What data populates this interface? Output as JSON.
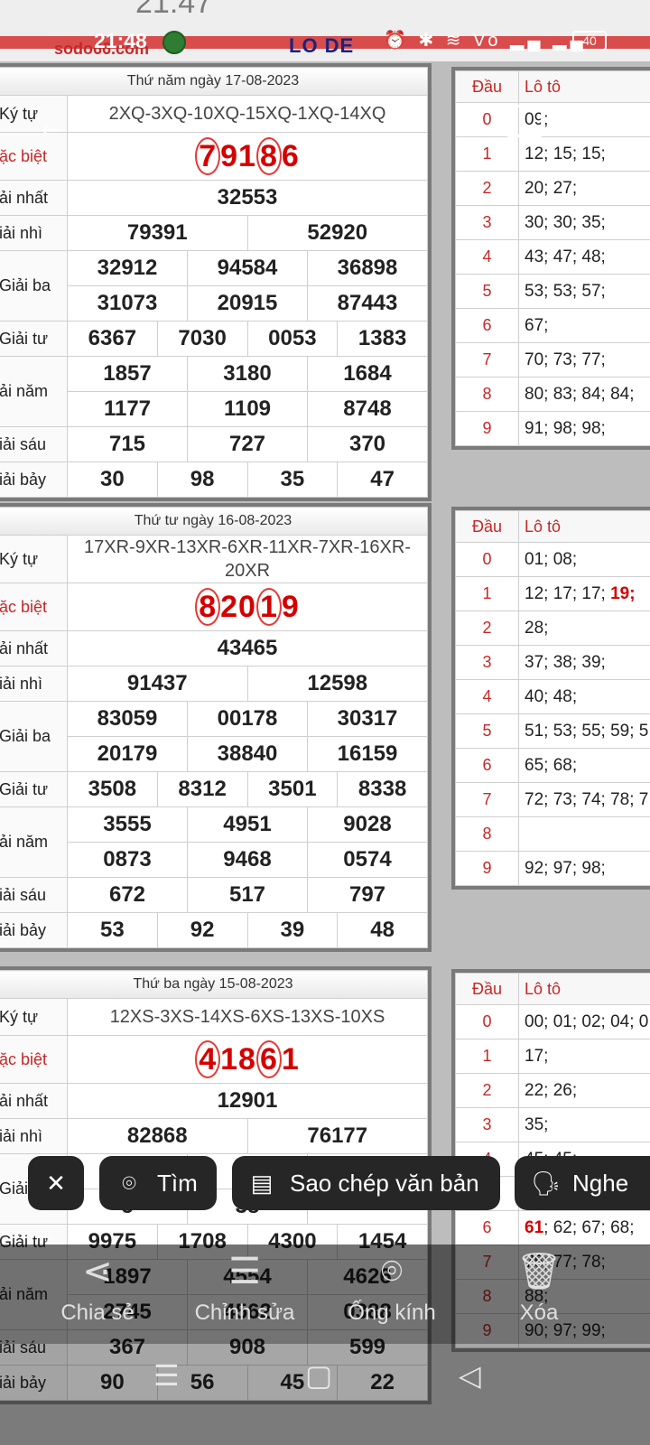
{
  "status": {
    "time": "21:48",
    "battery": "40",
    "icons": "⏰ ✱ ≋ Vo ▂▄ ▂▄"
  },
  "banner": {
    "brand": "sodo66.com",
    "lode": "LO DE",
    "ghost_time": "21:47"
  },
  "draws": [
    {
      "date": "Thứ năm ngày 17-08-2023",
      "kytu": "2XQ-3XQ-10XQ-15XQ-1XQ-14XQ",
      "labels": {
        "kytu": "Ký tự",
        "db": "ặc biệt",
        "g1": "ải nhất",
        "g2": "iải nhì",
        "g3": "Giải ba",
        "g4": "Giải tư",
        "g5": "ải năm",
        "g6": "iải sáu",
        "g7": "iải bảy"
      },
      "db": [
        "7",
        "9",
        "1",
        "8",
        "6"
      ],
      "g1": "32553",
      "g2": [
        "79391",
        "52920"
      ],
      "g3": [
        "32912",
        "94584",
        "36898",
        "31073",
        "20915",
        "87443"
      ],
      "g4": [
        "6367",
        "7030",
        "0053",
        "1383"
      ],
      "g5": [
        "1857",
        "3180",
        "1684",
        "1177",
        "1109",
        "8748"
      ],
      "g6": [
        "715",
        "727",
        "370"
      ],
      "g7": [
        "30",
        "98",
        "35",
        "47"
      ],
      "loto_header": {
        "dau": "Đầu",
        "loto": "Lô tô"
      },
      "loto": [
        {
          "d": "0",
          "v": "09;"
        },
        {
          "d": "1",
          "v": "12; 15; 15;"
        },
        {
          "d": "2",
          "v": "20; 27;"
        },
        {
          "d": "3",
          "v": "30; 30; 35;"
        },
        {
          "d": "4",
          "v": "43; 47; 48;"
        },
        {
          "d": "5",
          "v": "53; 53; 57;"
        },
        {
          "d": "6",
          "v": "67;"
        },
        {
          "d": "7",
          "v": "70; 73; 77;"
        },
        {
          "d": "8",
          "v": "80; 83; 84; 84;"
        },
        {
          "d": "9",
          "v": "91; 98; 98;"
        }
      ]
    },
    {
      "date": "Thứ tư ngày 16-08-2023",
      "kytu": "17XR-9XR-13XR-6XR-11XR-7XR-16XR-20XR",
      "labels": {
        "kytu": "Ký tự",
        "db": "ặc biệt",
        "g1": "ải nhất",
        "g2": "iải nhì",
        "g3": "Giải ba",
        "g4": "Giải tư",
        "g5": "ải năm",
        "g6": "iải sáu",
        "g7": "iải bảy"
      },
      "db": [
        "8",
        "2",
        "0",
        "1",
        "9"
      ],
      "g1": "43465",
      "g2": [
        "91437",
        "12598"
      ],
      "g3": [
        "83059",
        "00178",
        "30317",
        "20179",
        "38840",
        "16159"
      ],
      "g4": [
        "3508",
        "8312",
        "3501",
        "8338"
      ],
      "g5": [
        "3555",
        "4951",
        "9028",
        "0873",
        "9468",
        "0574"
      ],
      "g6": [
        "672",
        "517",
        "797"
      ],
      "g7": [
        "53",
        "92",
        "39",
        "48"
      ],
      "loto_header": {
        "dau": "Đầu",
        "loto": "Lô tô"
      },
      "loto": [
        {
          "d": "0",
          "v": "01; 08;"
        },
        {
          "d": "1",
          "v": "12; 17; 17; ",
          "hl": "19;"
        },
        {
          "d": "2",
          "v": "28;"
        },
        {
          "d": "3",
          "v": "37; 38; 39;"
        },
        {
          "d": "4",
          "v": "40; 48;"
        },
        {
          "d": "5",
          "v": "51; 53; 55; 59; 5"
        },
        {
          "d": "6",
          "v": "65; 68;"
        },
        {
          "d": "7",
          "v": "72; 73; 74; 78; 7"
        },
        {
          "d": "8",
          "v": ""
        },
        {
          "d": "9",
          "v": "92; 97; 98;"
        }
      ]
    },
    {
      "date": "Thứ ba ngày 15-08-2023",
      "kytu": "12XS-3XS-14XS-6XS-13XS-10XS",
      "labels": {
        "kytu": "Ký tự",
        "db": "ặc biệt",
        "g1": "ải nhất",
        "g2": "iải nhì",
        "g3": "Giải ba",
        "g4": "Giải tư",
        "g5": "ải năm",
        "g6": "iải sáu",
        "g7": "iải bảy"
      },
      "db": [
        "4",
        "1",
        "8",
        "6",
        "1"
      ],
      "g1": "12901",
      "g2": [
        "82868",
        "76177"
      ],
      "g3": [
        "0",
        "47",
        "",
        "5",
        "38",
        ""
      ],
      "g4": [
        "9975",
        "1708",
        "4300",
        "1454"
      ],
      "g5": [
        "1897",
        "4554",
        "4626",
        "2745",
        "4562",
        "0388"
      ],
      "g6": [
        "367",
        "908",
        "599"
      ],
      "g7": [
        "90",
        "56",
        "45",
        "22"
      ],
      "loto_header": {
        "dau": "Đầu",
        "loto": "Lô tô"
      },
      "loto": [
        {
          "d": "0",
          "v": "00; 01; 02; 04; 0"
        },
        {
          "d": "1",
          "v": "17;"
        },
        {
          "d": "2",
          "v": "22; 26;"
        },
        {
          "d": "3",
          "v": "35;"
        },
        {
          "d": "4",
          "v": "45; 45;"
        },
        {
          "d": "5",
          "v": ""
        },
        {
          "d": "6",
          "hl": "61",
          "v": "; 62; 67; 68;"
        },
        {
          "d": "7",
          "v": "75; 77; 78;"
        },
        {
          "d": "8",
          "v": "88;"
        },
        {
          "d": "9",
          "v": "90; 97; 99;"
        }
      ]
    }
  ],
  "lens": {
    "chips": [
      {
        "label": "",
        "icon": "✕"
      },
      {
        "label": "Tìm",
        "icon": "⌾"
      },
      {
        "label": "Sao chép văn bản",
        "icon": "▤"
      },
      {
        "label": "Nghe",
        "icon": "🗣"
      }
    ],
    "bottom": [
      {
        "label": "Chia sẻ",
        "icon": "⋖"
      },
      {
        "label": "Chỉnh sửa",
        "icon": "☰"
      },
      {
        "label": "Ống kính",
        "icon": "⌾"
      },
      {
        "label": "Xóa",
        "icon": "🗑"
      }
    ]
  },
  "nav": {
    "recent": "☰",
    "home": "▢",
    "back": "◁"
  }
}
